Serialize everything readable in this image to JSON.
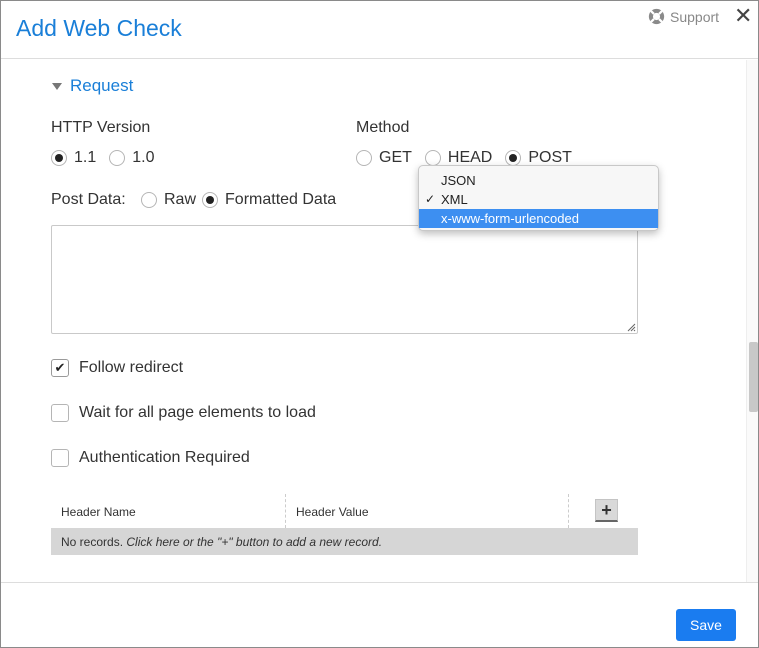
{
  "dialog": {
    "title": "Add Web Check",
    "support_label": "Support",
    "close_glyph": "✕"
  },
  "request": {
    "section_label": "Request",
    "http_version": {
      "label": "HTTP Version",
      "options": [
        "1.1",
        "1.0"
      ],
      "selected": "1.1"
    },
    "method": {
      "label": "Method",
      "options": [
        "GET",
        "HEAD",
        "POST"
      ],
      "selected": "POST"
    },
    "post_data": {
      "label": "Post Data:",
      "options": [
        "Raw",
        "Formatted Data"
      ],
      "selected": "Formatted Data",
      "value": ""
    },
    "format_dropdown": {
      "options": [
        "JSON",
        "XML",
        "x-www-form-urlencoded"
      ],
      "checked": "XML",
      "highlighted": "x-www-form-urlencoded",
      "check_glyph": "✓"
    },
    "follow_redirect": {
      "label": "Follow redirect",
      "checked": true
    },
    "wait_elements": {
      "label": "Wait for all page elements to load",
      "checked": false
    },
    "auth_required": {
      "label": "Authentication Required",
      "checked": false
    }
  },
  "headers_grid": {
    "columns": [
      "Header Name",
      "Header Value"
    ],
    "add_glyph": "+",
    "empty_prefix": "No records. ",
    "empty_message": "Click here or the \"+\" button to add a new record."
  },
  "footer": {
    "save_label": "Save"
  },
  "colors": {
    "accent": "#1a7fd8",
    "button": "#1a7cf0",
    "highlight": "#3d8ff1"
  },
  "icons": {
    "support": "lifebuoy-icon",
    "close": "close-icon",
    "toggle": "triangle-down-icon",
    "add": "plus-icon"
  }
}
